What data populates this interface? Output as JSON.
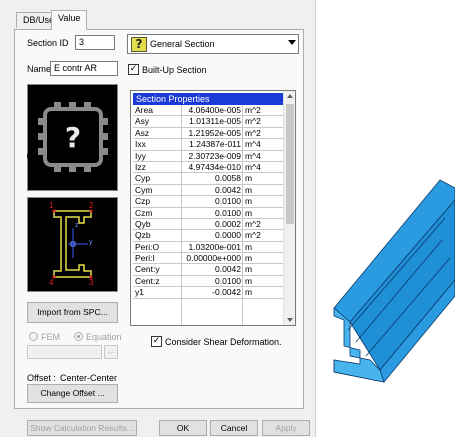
{
  "tabs": [
    "DB/User",
    "Value"
  ],
  "section_id": {
    "label": "Section ID",
    "value": "3"
  },
  "section_type": {
    "value": "General Section",
    "icon": "question-mark-icon"
  },
  "name": {
    "label": "Name",
    "value": "E contr AR"
  },
  "built_up": {
    "label": "Built-Up Section",
    "checked": true
  },
  "point_labels": [
    "1",
    "2",
    "3",
    "4"
  ],
  "axis_labels": {
    "z": "z",
    "y": "y"
  },
  "import_button": "Import from SPC...",
  "radios": {
    "fem": "FEM",
    "equation": "Equation"
  },
  "offset": {
    "label": "Offset :",
    "value": "Center-Center",
    "button": "Change Offset ..."
  },
  "table": {
    "header": "Section Properties",
    "rows": [
      {
        "name": "Area",
        "value": "4.06400e-005",
        "unit": "m^2"
      },
      {
        "name": "Asy",
        "value": "1.01311e-005",
        "unit": "m^2"
      },
      {
        "name": "Asz",
        "value": "1.21952e-005",
        "unit": "m^2"
      },
      {
        "name": "Ixx",
        "value": "1.24387e-011",
        "unit": "m^4"
      },
      {
        "name": "Iyy",
        "value": "2.30723e-009",
        "unit": "m^4"
      },
      {
        "name": "Izz",
        "value": "4.97434e-010",
        "unit": "m^4"
      },
      {
        "name": "Cyp",
        "value": "0.0058",
        "unit": "m"
      },
      {
        "name": "Cym",
        "value": "0.0042",
        "unit": "m"
      },
      {
        "name": "Czp",
        "value": "0.0100",
        "unit": "m"
      },
      {
        "name": "Czm",
        "value": "0.0100",
        "unit": "m"
      },
      {
        "name": "Qyb",
        "value": "0.0002",
        "unit": "m^2"
      },
      {
        "name": "Qzb",
        "value": "0.0000",
        "unit": "m^2"
      },
      {
        "name": "Peri:O",
        "value": "1.03200e-001",
        "unit": "m"
      },
      {
        "name": "Peri:I",
        "value": "0.00000e+000",
        "unit": "m"
      },
      {
        "name": "Cent:y",
        "value": "0.0042",
        "unit": "m"
      },
      {
        "name": "Cent:z",
        "value": "0.0100",
        "unit": "m"
      },
      {
        "name": "y1",
        "value": "-0.0042",
        "unit": "m"
      }
    ]
  },
  "shear_deformation": {
    "label": "Consider Shear Deformation.",
    "checked": true
  },
  "bottom_buttons": [
    "Show Calculation Results...",
    "OK",
    "Cancel",
    "Apply"
  ],
  "colors": {
    "header_blue": "#1c3bd6",
    "profile_yellow": "#e6e04a",
    "point_red": "#e02020",
    "beam_blue": "#1f8fd6"
  }
}
